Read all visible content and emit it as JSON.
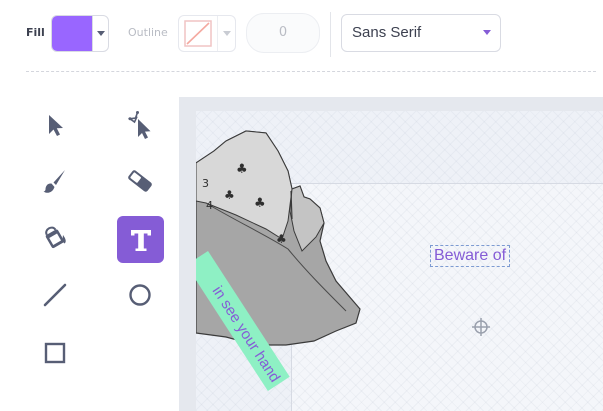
{
  "toolbar": {
    "fill_label": "Fill",
    "fill_color": "#9966ff",
    "outline_label": "Outline",
    "outline_width": "0",
    "font_name": "Sans Serif"
  },
  "tools": [
    {
      "name": "select-tool",
      "icon": "arrow-cursor-icon",
      "selected": false
    },
    {
      "name": "reshape-tool",
      "icon": "reshape-cursor-icon",
      "selected": false
    },
    {
      "name": "brush-tool",
      "icon": "brush-icon",
      "selected": false
    },
    {
      "name": "eraser-tool",
      "icon": "eraser-icon",
      "selected": false
    },
    {
      "name": "fill-tool",
      "icon": "paint-bucket-icon",
      "selected": false
    },
    {
      "name": "text-tool",
      "icon": "text-t-icon",
      "selected": true
    },
    {
      "name": "line-tool",
      "icon": "line-icon",
      "selected": false
    },
    {
      "name": "circle-tool",
      "icon": "circle-icon",
      "selected": false
    },
    {
      "name": "rectangle-tool",
      "icon": "square-icon",
      "selected": false
    }
  ],
  "canvas": {
    "text_object": "Beware of",
    "banner_text": "in see your hand"
  },
  "colors": {
    "accent": "#855cd6",
    "banner": "#8ef0c4"
  }
}
